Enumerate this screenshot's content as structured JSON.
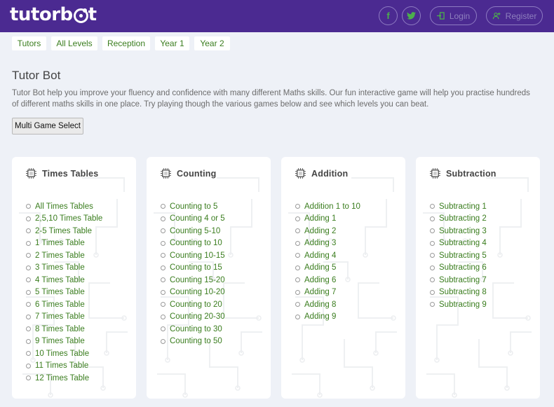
{
  "header": {
    "logo_text": "tutorb",
    "logo_text_end": "t",
    "login_label": "Login",
    "register_label": "Register",
    "facebook_glyph": "f",
    "twitter_glyph": "t"
  },
  "breadcrumb": [
    "Tutors",
    "All Levels",
    "Reception",
    "Year 1",
    "Year 2"
  ],
  "page": {
    "title": "Tutor Bot",
    "intro": "Tutor Bot help you improve your fluency and confidence with many different Maths skills. Our fun interactive game will help you practise hundreds of different maths skills in one place. Try playing though the various games below and see which levels you can beat.",
    "multi_game_label": "Multi Game Select"
  },
  "cards": [
    {
      "title": "Times Tables",
      "items": [
        "All Times Tables",
        "2,5,10 Times Table",
        "2-5 Times Table",
        "1 Times Table",
        "2 Times Table",
        "3 Times Table",
        "4 Times Table",
        "5 Times Table",
        "6 Times Table",
        "7 Times Table",
        "8 Times Table",
        "9 Times Table",
        "10 Times Table",
        "11 Times Table",
        "12 Times Table"
      ]
    },
    {
      "title": "Counting",
      "items": [
        "Counting to 5",
        "Counting 4 or 5",
        "Counting 5-10",
        "Counting to 10",
        "Counting 10-15",
        "Counting to 15",
        "Counting 15-20",
        "Counting 10-20",
        "Counting to 20",
        "Counting 20-30",
        "Counting to 30",
        "Counting to 50"
      ]
    },
    {
      "title": "Addition",
      "items": [
        "Addition 1 to 10",
        "Adding 1",
        "Adding 2",
        "Adding 3",
        "Adding 4",
        "Adding 5",
        "Adding 6",
        "Adding 7",
        "Adding 8",
        "Adding 9"
      ]
    },
    {
      "title": "Subtraction",
      "items": [
        "Subtracting 1",
        "Subtracting 2",
        "Subtracting 3",
        "Subtracting 4",
        "Subtracting 5",
        "Subtracting 6",
        "Subtracting 7",
        "Subtracting 8",
        "Subtracting 9"
      ]
    }
  ],
  "colors": {
    "header_bg": "#4b2a91",
    "link_green": "#3a7d1e",
    "icon_green": "#4cae4c",
    "page_bg": "#eef1f7"
  },
  "icons": {
    "facebook": "facebook-icon",
    "twitter": "twitter-icon",
    "login": "login-icon",
    "register": "register-icon",
    "card": "cpu-chip-icon",
    "bullet": "circle-bullet-icon"
  }
}
